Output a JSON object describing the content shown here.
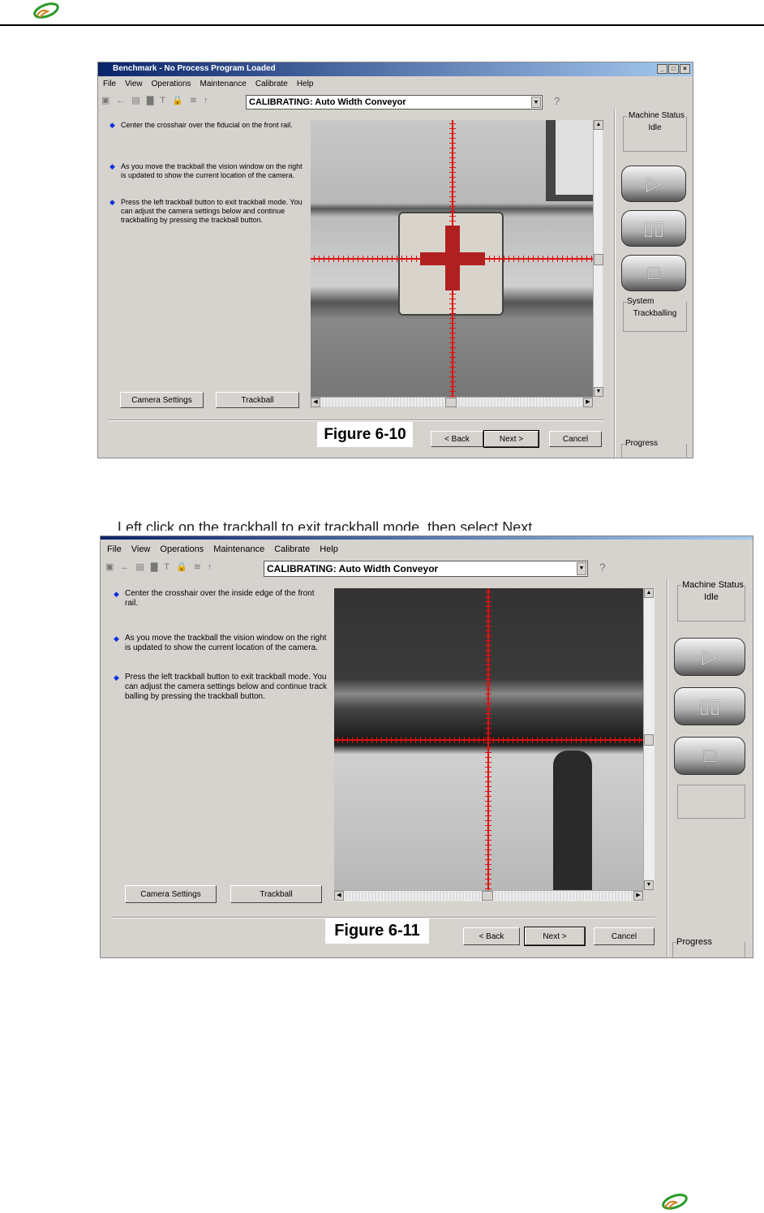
{
  "header": {
    "logo": "company-swirl-logo"
  },
  "figures": [
    {
      "window_title": "Benchmark - No Process Program Loaded",
      "menu": [
        "File",
        "View",
        "Operations",
        "Maintenance",
        "Calibrate",
        "Help"
      ],
      "toolbar_combo": "CALIBRATING: Auto Width Conveyor",
      "instructions": [
        "Center the crosshair over the fiducial on the front rail.",
        "As you move the trackball the vision window on the right is updated to show the current location of the camera.",
        "Press the left trackball button to exit trackball mode. You can adjust the camera settings below and continue trackballing by pressing the  trackball button."
      ],
      "camera_settings": "Camera Settings",
      "trackball": "Trackball",
      "label": "Figure 6-10",
      "back": "< Back",
      "next": "Next >",
      "cancel": "Cancel",
      "machine_status_label": "Machine Status",
      "machine_status": "Idle",
      "system_label": "System",
      "system_status": "Trackballing",
      "progress_label": "Progress"
    },
    {
      "clipped_caption": "Left click on the trackball to exit trackball mode, then select Next.",
      "menu": [
        "File",
        "View",
        "Operations",
        "Maintenance",
        "Calibrate",
        "Help"
      ],
      "toolbar_combo": "CALIBRATING: Auto Width Conveyor",
      "instructions": [
        "Center the crosshair over the inside edge of the front rail.",
        "As you move the trackball the vision window on the right is updated to show the current location of the camera.",
        "Press the left trackball button to exit trackball mode. You can adjust the camera settings below and continue track balling by pressing the  trackball button."
      ],
      "camera_settings": "Camera Settings",
      "trackball": "Trackball",
      "label": "Figure 6-11",
      "back": "< Back",
      "next": "Next >",
      "cancel": "Cancel",
      "machine_status_label": "Machine Status",
      "machine_status": "Idle",
      "progress_label": "Progress"
    }
  ],
  "colors": {
    "crosshair": "#e01010",
    "titlebar": "#0a246a",
    "bullet": "#1030e0"
  }
}
